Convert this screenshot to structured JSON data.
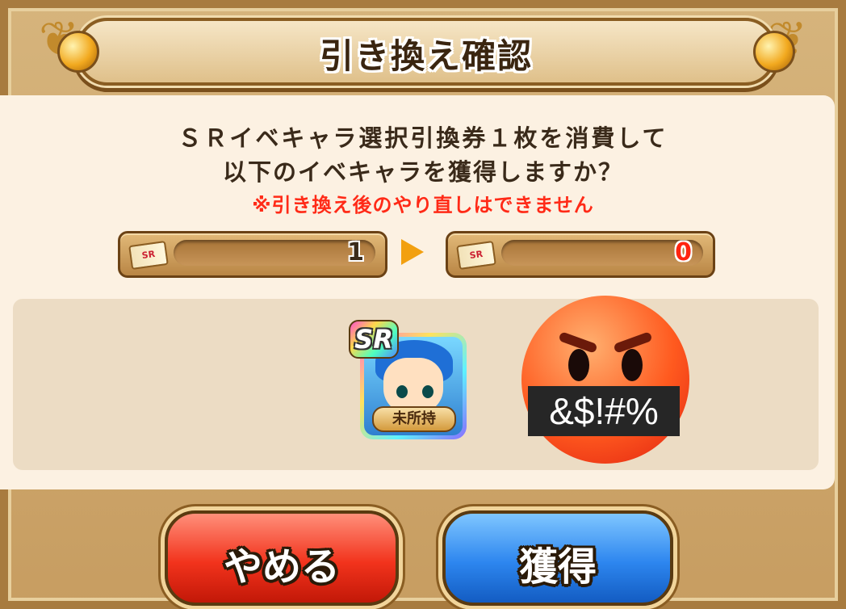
{
  "dialog": {
    "title": "引き換え確認",
    "message_line1": "ＳＲイベキャラ選択引換券１枚を消費して",
    "message_line2": "以下のイベキャラを獲得しますか？",
    "warning": "※引き換え後のやり直しはできません"
  },
  "ticket_counter": {
    "before": "1",
    "after": "0",
    "ticket_icon_text": "SR"
  },
  "character": {
    "rarity_badge": "SR",
    "status_label": "未所持"
  },
  "sticker": {
    "text": "&$!#%"
  },
  "buttons": {
    "cancel_label": "やめる",
    "confirm_label": "獲得"
  },
  "colors": {
    "warning": "#ff2a17",
    "cancel_button": "#f2331c",
    "confirm_button": "#2d86ef",
    "arrow": "#f2a010"
  }
}
